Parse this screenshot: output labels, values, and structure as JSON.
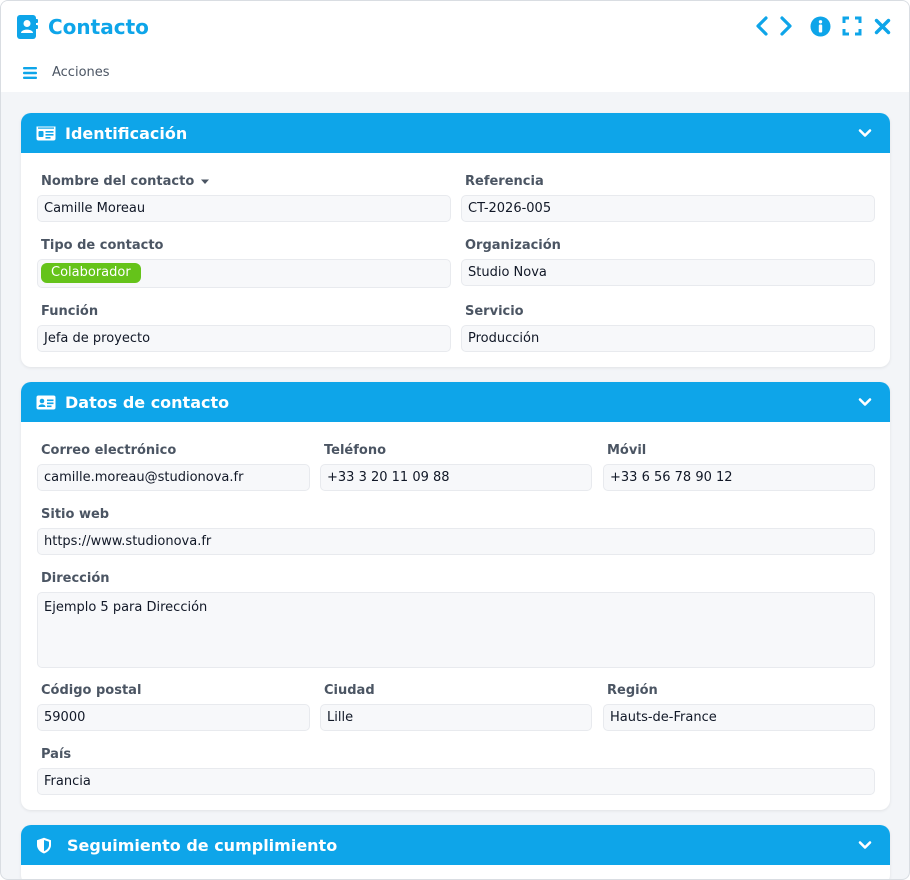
{
  "window": {
    "title": "Contacto",
    "actions_label": "Acciones",
    "accent_color": "#0ea5e9"
  },
  "sections": {
    "identificacion": {
      "title": "Identificación",
      "icon": "id-card-icon",
      "fields": {
        "nombre": {
          "label": "Nombre del contacto",
          "value": "Camille Moreau"
        },
        "referencia": {
          "label": "Referencia",
          "value": "CT-2026-005"
        },
        "tipo": {
          "label": "Tipo de contacto",
          "value": "Colaborador",
          "badge_color": "#65c31a"
        },
        "organizacion": {
          "label": "Organización",
          "value": "Studio Nova"
        },
        "funcion": {
          "label": "Función",
          "value": "Jefa de proyecto"
        },
        "servicio": {
          "label": "Servicio",
          "value": "Producción"
        }
      }
    },
    "datos": {
      "title": "Datos de contacto",
      "icon": "address-card-icon",
      "fields": {
        "correo": {
          "label": "Correo electrónico",
          "value": "camille.moreau@studionova.fr"
        },
        "telefono": {
          "label": "Teléfono",
          "value": "+33 3 20 11 09 88"
        },
        "movil": {
          "label": "Móvil",
          "value": "+33 6 56 78 90 12"
        },
        "web": {
          "label": "Sitio web",
          "value": "https://www.studionova.fr"
        },
        "direccion": {
          "label": "Dirección",
          "value": "Ejemplo 5 para Dirección"
        },
        "cp": {
          "label": "Código postal",
          "value": "59000"
        },
        "ciudad": {
          "label": "Ciudad",
          "value": "Lille"
        },
        "region": {
          "label": "Región",
          "value": "Hauts-de-France"
        },
        "pais": {
          "label": "País",
          "value": "Francia"
        }
      }
    },
    "seguimiento": {
      "title": "Seguimiento de cumplimiento",
      "icon": "shield-icon"
    }
  }
}
